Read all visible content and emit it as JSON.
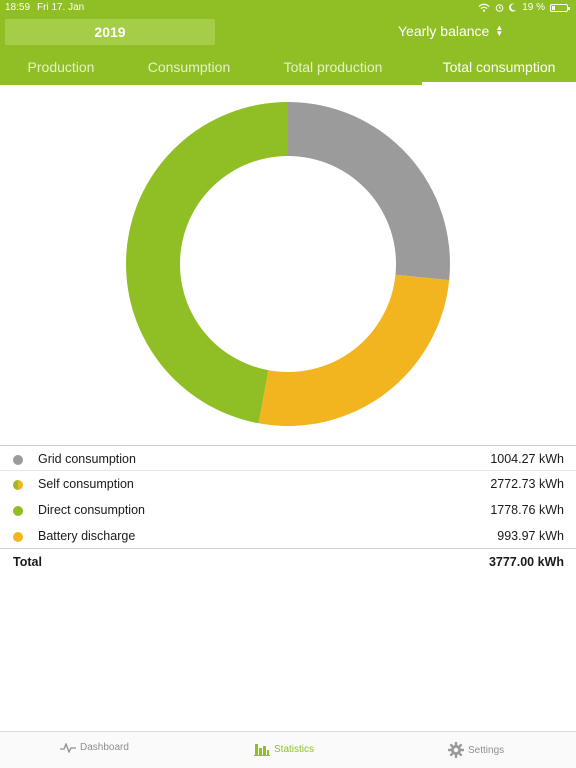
{
  "status": {
    "time": "18:59",
    "date": "Fri 17. Jan",
    "battery": "19 %",
    "battery_level": 0.19
  },
  "header": {
    "year": "2019",
    "mode": "Yearly balance"
  },
  "tabs": [
    {
      "label": "Production",
      "active": false
    },
    {
      "label": "Consumption",
      "active": false
    },
    {
      "label": "Total production",
      "active": false
    },
    {
      "label": "Total consumption",
      "active": true
    }
  ],
  "colors": {
    "accent": "#8fbf24",
    "grid": "#9b9b9b",
    "direct": "#8fbf24",
    "battery": "#f2b51f"
  },
  "chart_data": {
    "type": "pie",
    "donut": true,
    "slices": [
      {
        "label": "Grid consumption",
        "value": 1004.27,
        "color": "#9b9b9b"
      },
      {
        "label": "Battery discharge",
        "value": 993.97,
        "color": "#f2b51f"
      },
      {
        "label": "Direct consumption",
        "value": 1778.76,
        "color": "#8fbf24"
      }
    ]
  },
  "breakdown": {
    "rows": [
      {
        "label": "Grid consumption",
        "value": "1004.27 kWh"
      },
      {
        "label": "Self consumption",
        "value": "2772.73 kWh"
      },
      {
        "label": "Direct consumption",
        "value": "1778.76 kWh"
      },
      {
        "label": "Battery discharge",
        "value": "993.97 kWh"
      }
    ],
    "total_label": "Total",
    "total_value": "3777.00 kWh"
  },
  "tabbar": [
    {
      "label": "Dashboard",
      "icon": "pulse-icon",
      "active": false
    },
    {
      "label": "Statistics",
      "icon": "bar-chart-icon",
      "active": true
    },
    {
      "label": "Settings",
      "icon": "gear-icon",
      "active": false
    }
  ]
}
